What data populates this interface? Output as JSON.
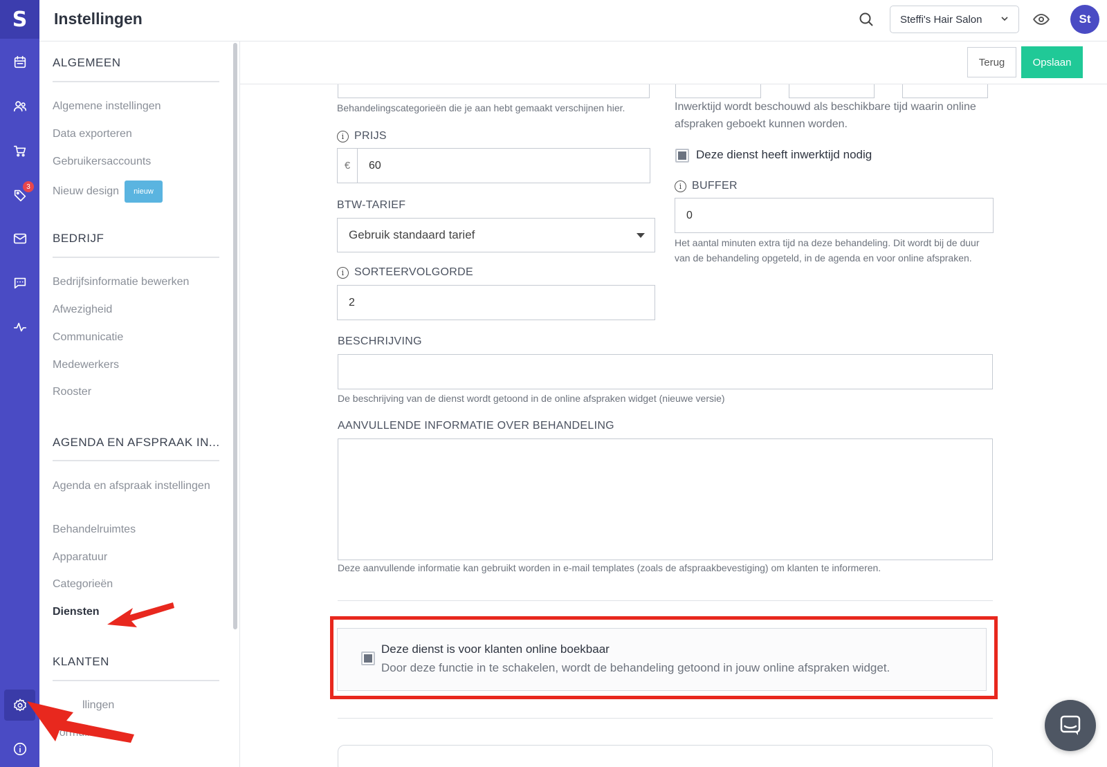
{
  "app": {
    "logo_letter": "S",
    "page_title": "Instellingen"
  },
  "rail": {
    "icons": [
      "calendar-icon",
      "clients-icon",
      "cart-icon",
      "tag-icon",
      "mail-icon",
      "chat-icon",
      "activity-icon",
      "settings-icon",
      "info-icon"
    ],
    "tag_badge": "3"
  },
  "header": {
    "salon": "Steffi's Hair Salon",
    "avatar": "St"
  },
  "sidebar": {
    "sections": [
      {
        "title": "ALGEMEEN",
        "items": [
          "Algemene instellingen",
          "Data exporteren",
          "Gebruikersaccounts",
          "Nieuw design"
        ]
      },
      {
        "title": "BEDRIJF",
        "items": [
          "Bedrijfsinformatie bewerken",
          "Afwezigheid",
          "Communicatie",
          "Medewerkers",
          "Rooster"
        ]
      },
      {
        "title": "AGENDA EN AFSPRAAK IN...",
        "items": [
          "Agenda en afspraak instellingen",
          "Behandelruimtes",
          "Apparatuur",
          "Categorieën",
          "Diensten"
        ]
      },
      {
        "title": "KLANTEN",
        "items": [
          "Instellingen",
          "Formulieren"
        ]
      }
    ],
    "new_badge": "nieuw",
    "partial_item_text": "llingen"
  },
  "actions": {
    "back": "Terug",
    "save": "Opslaan"
  },
  "form": {
    "category_hint": "Behandelingscategorieën die je aan hebt gemaakt verschijnen hier.",
    "price": {
      "label": "PRIJS",
      "currency": "€",
      "value": "60"
    },
    "vat": {
      "label": "BTW-TARIEF",
      "value": "Gebruik standaard tarief"
    },
    "sort": {
      "label": "SORTEERVOLGORDE",
      "value": "2"
    },
    "processing_hint": "Inwerktijd wordt beschouwd als beschikbare tijd waarin online afspraken geboekt kunnen worden.",
    "processing_checkbox": "Deze dienst heeft inwerktijd nodig",
    "buffer": {
      "label": "BUFFER",
      "value": "0",
      "hint": "Het aantal minuten extra tijd na deze behandeling. Dit wordt bij de duur van de behandeling opgeteld, in de agenda en voor online afspraken."
    },
    "description": {
      "label": "BESCHRIJVING",
      "value": "",
      "hint": "De beschrijving van de dienst wordt getoond in de online afspraken widget (nieuwe versie)"
    },
    "extra_info": {
      "label": "AANVULLENDE INFORMATIE OVER BEHANDELING",
      "value": "",
      "hint": "Deze aanvullende informatie kan gebruikt worden in e-mail templates (zoals de afspraakbevestiging) om klanten te informeren."
    },
    "online_booking": {
      "title": "Deze dienst is voor klanten online boekbaar",
      "subtitle": "Door deze functie in te schakelen, wordt de behandeling getoond in jouw online afspraken widget.",
      "checked": true
    }
  },
  "colors": {
    "rail": "#4a4bc4",
    "save": "#20c997",
    "highlight": "#e8281e",
    "arrow": "#e8281e"
  }
}
